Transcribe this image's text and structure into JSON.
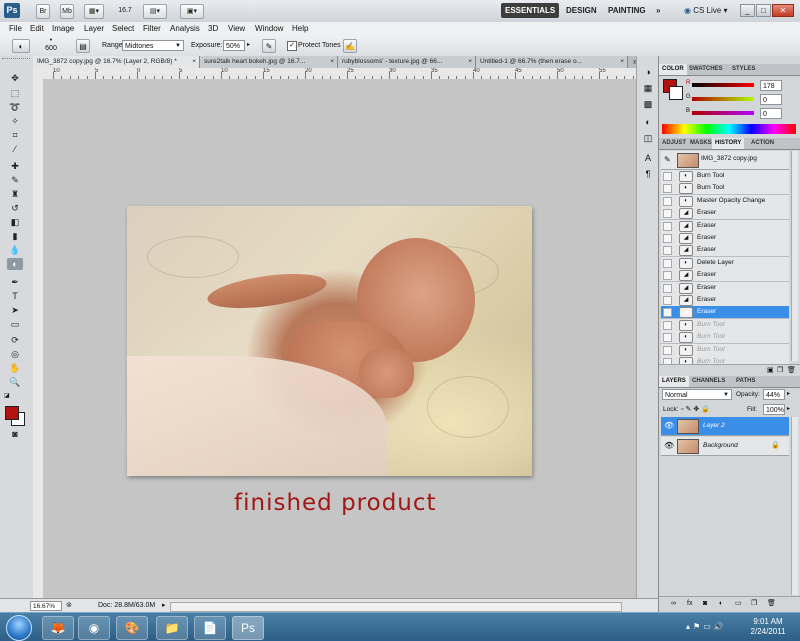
{
  "titlebar": {
    "app_logo": "Ps",
    "zoom": "16.7",
    "workspaces": [
      "ESSENTIALS",
      "DESIGN",
      "PAINTING"
    ],
    "more": "»",
    "cs_live": "CS Live",
    "window_min": "_",
    "window_max": "□",
    "window_close": "✕"
  },
  "menu": [
    "File",
    "Edit",
    "Image",
    "Layer",
    "Select",
    "Filter",
    "Analysis",
    "3D",
    "View",
    "Window",
    "Help"
  ],
  "options": {
    "brush_size": "600",
    "range_label": "Range:",
    "range_value": "Midtones",
    "exposure_label": "Exposure:",
    "exposure_value": "50%",
    "protect_tones_label": "Protect Tones",
    "protect_tones_checked": "✓"
  },
  "doc_tabs": [
    "IMG_3872 copy.jpg @ 16.7% (Layer 2, RGB/8) *",
    "sure2talk heart bokeh.jpg @ 16.7...",
    "rubyblossoms' - texture.jpg @ 66...",
    "Untitled-1 @ 66.7% (then erase o..."
  ],
  "ruler_top": [
    "10",
    "5",
    "0",
    "5",
    "10",
    "15",
    "20",
    "25",
    "30",
    "35",
    "40",
    "45",
    "50",
    "55"
  ],
  "canvas": {
    "caption": "finished product"
  },
  "status": {
    "zoom": "16.67%",
    "doc": "Doc: 28.8M/63.0M"
  },
  "color_panel": {
    "tabs": [
      "COLOR",
      "SWATCHES",
      "STYLES"
    ],
    "r_label": "R",
    "g_label": "G",
    "b_label": "B",
    "r_value": "178",
    "g_value": "0",
    "b_value": "0",
    "fg_color": "#b2120f"
  },
  "history_panel": {
    "tabs": [
      "ADJUST",
      "MASKS",
      "HISTORY",
      "ACTION"
    ],
    "snapshot": "IMG_3872 copy.jpg",
    "items": [
      {
        "label": "Burn Tool",
        "state": "normal"
      },
      {
        "label": "Burn Tool",
        "state": "normal"
      },
      {
        "label": "Master Opacity Change",
        "state": "normal"
      },
      {
        "label": "Eraser",
        "state": "normal"
      },
      {
        "label": "Eraser",
        "state": "normal"
      },
      {
        "label": "Eraser",
        "state": "normal"
      },
      {
        "label": "Eraser",
        "state": "normal"
      },
      {
        "label": "Delete Layer",
        "state": "normal"
      },
      {
        "label": "Eraser",
        "state": "normal"
      },
      {
        "label": "Eraser",
        "state": "normal"
      },
      {
        "label": "Eraser",
        "state": "normal"
      },
      {
        "label": "Eraser",
        "state": "selected"
      },
      {
        "label": "Burn Tool",
        "state": "dim"
      },
      {
        "label": "Burn Tool",
        "state": "dim"
      },
      {
        "label": "Burn Tool",
        "state": "dim"
      },
      {
        "label": "Burn Tool",
        "state": "dim"
      }
    ]
  },
  "layers_panel": {
    "tabs": [
      "LAYERS",
      "CHANNELS",
      "PATHS"
    ],
    "blend_mode": "Normal",
    "opacity_label": "Opacity:",
    "opacity_value": "44%",
    "lock_label": "Lock:",
    "fill_label": "Fill:",
    "fill_value": "100%",
    "layers": [
      {
        "name": "Layer 2",
        "selected": true
      },
      {
        "name": "Background",
        "selected": false
      }
    ]
  },
  "taskbar": {
    "time": "9:01 AM",
    "date": "2/24/2011",
    "apps": [
      "firefox-icon",
      "chrome-icon",
      "paint-icon",
      "folder-icon",
      "document-icon",
      "photoshop-icon"
    ]
  },
  "colors": {
    "accent_selection": "#3b8ee8",
    "caption_red": "#a31616"
  }
}
